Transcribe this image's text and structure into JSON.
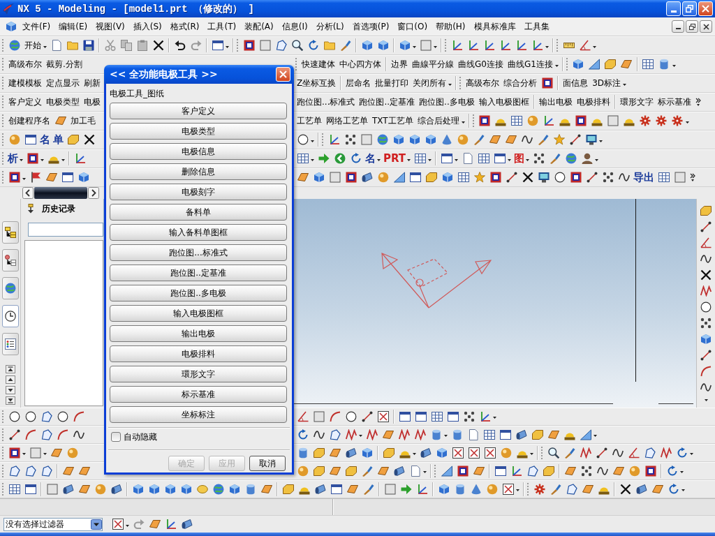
{
  "window": {
    "title": "NX 5 - Modeling - [model1.prt （修改的） ]"
  },
  "menu_bar": {
    "items": [
      "文件(F)",
      "编辑(E)",
      "视图(V)",
      "插入(S)",
      "格式(R)",
      "工具(T)",
      "装配(A)",
      "信息(I)",
      "分析(L)",
      "首选项(P)",
      "窗口(O)",
      "帮助(H)",
      "模具标准库",
      "工具集"
    ]
  },
  "toolbar_rows": [
    {
      "items": [
        {
          "kind": "text",
          "label": "开始"
        }
      ]
    },
    {
      "items": [
        {
          "kind": "text",
          "label": "高级布尔"
        },
        {
          "kind": "text",
          "label": "截剪.分割"
        },
        {
          "kind": "text",
          "label": "快速建体"
        },
        {
          "kind": "text",
          "label": "中心四方体"
        },
        {
          "kind": "text",
          "label": "边界"
        },
        {
          "kind": "text",
          "label": "曲線平分線"
        },
        {
          "kind": "text",
          "label": "曲线G0连接"
        },
        {
          "kind": "text",
          "label": "曲线G1连接"
        }
      ]
    },
    {
      "items": [
        {
          "kind": "text",
          "label": "建模模板"
        },
        {
          "kind": "text",
          "label": "定点显示"
        },
        {
          "kind": "text",
          "label": "刷新"
        },
        {
          "kind": "text",
          "label": "Z坐标互换"
        },
        {
          "kind": "text",
          "label": "层命名"
        },
        {
          "kind": "text",
          "label": "批量打印"
        },
        {
          "kind": "text",
          "label": "关闭所有"
        },
        {
          "kind": "text",
          "label": "高级布尔"
        },
        {
          "kind": "text",
          "label": "综合分析"
        },
        {
          "kind": "text",
          "label": "面信息"
        },
        {
          "kind": "text",
          "label": "3D标注"
        }
      ]
    },
    {
      "items": [
        {
          "kind": "text",
          "label": "客户定义"
        },
        {
          "kind": "text",
          "label": "电极类型"
        },
        {
          "kind": "text",
          "label": "电极"
        },
        {
          "kind": "text",
          "label": "跑位图...标准式"
        },
        {
          "kind": "text",
          "label": "跑位图..定基准"
        },
        {
          "kind": "text",
          "label": "跑位图..多电极"
        },
        {
          "kind": "text",
          "label": "输入电极图框"
        },
        {
          "kind": "text",
          "label": "输出电极"
        },
        {
          "kind": "text",
          "label": "电极排料"
        },
        {
          "kind": "text",
          "label": "環形文字"
        },
        {
          "kind": "text",
          "label": "标示基准"
        }
      ]
    },
    {
      "items": [
        {
          "kind": "text",
          "label": "创建程序名"
        },
        {
          "kind": "text",
          "label": "加工毛"
        },
        {
          "kind": "text",
          "label": "工艺单"
        },
        {
          "kind": "text",
          "label": "网络工艺单"
        },
        {
          "kind": "text",
          "label": "TXT工艺单"
        },
        {
          "kind": "text",
          "label": "综合后处理"
        }
      ]
    },
    {
      "items": [
        {
          "kind": "glyph",
          "label": "名"
        },
        {
          "kind": "glyph",
          "label": "单"
        }
      ]
    },
    {
      "items": [
        {
          "kind": "glyph",
          "label": "析"
        },
        {
          "kind": "glyph",
          "label": "名"
        },
        {
          "kind": "redglyph",
          "label": "PRT"
        },
        {
          "kind": "redglyph",
          "label": "图"
        }
      ]
    },
    {
      "items": [
        {
          "kind": "glyph",
          "label": "导出"
        }
      ]
    }
  ],
  "resource_bar": {
    "tabs": [
      {
        "selected": false
      },
      {
        "selected": false
      },
      {
        "selected": false
      },
      {
        "selected": true
      },
      {
        "selected": false
      }
    ]
  },
  "navigator": {
    "title": "历史记录"
  },
  "dialog": {
    "title": "<< 全功能电极工具 >>",
    "group_label": "电极工具_图纸",
    "buttons": [
      "客户定义",
      "电极类型",
      "电极信息",
      "删除信息",
      "电极刻字",
      "备料单",
      "输入备料单图框",
      "跑位图...标准式",
      "跑位图..定基准",
      "跑位图..多电极",
      "输入电极图框",
      "输出电极",
      "电极排料",
      "環形文字",
      "标示基准",
      "坐标标注"
    ],
    "auto_hide": {
      "label": "自动隐藏",
      "checked": false
    },
    "actions": [
      {
        "label": "确定",
        "disabled": true
      },
      {
        "label": "应用",
        "disabled": true
      },
      {
        "label": "取消",
        "disabled": false
      }
    ]
  },
  "selection_filter": {
    "value": "没有选择过滤器"
  }
}
